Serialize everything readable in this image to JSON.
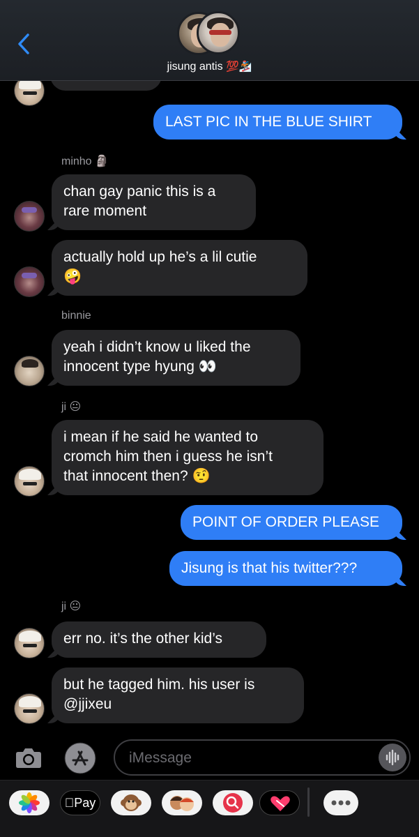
{
  "header": {
    "back_icon": "chevron-left-icon",
    "group_name": "jisung antis",
    "group_emoji": "💯🏂"
  },
  "messages": [
    {
      "side": "out",
      "text": "LAST PIC IN THE BLUE SHIRT"
    },
    {
      "side": "in",
      "sender": "minho 🗿",
      "text": "chan gay panic this is a\nrare moment"
    },
    {
      "side": "in",
      "text": "actually hold up he’s a lil cutie\n🤪"
    },
    {
      "side": "in",
      "sender": "binnie",
      "text": "yeah i didn’t know u liked the\ninnocent type hyung 👀"
    },
    {
      "side": "in",
      "sender": "ji 😐",
      "text": "i mean if he said he wanted to\ncromch him then i guess he isn’t\nthat innocent then? 🤨"
    },
    {
      "side": "out",
      "text": "POINT OF ORDER PLEASE"
    },
    {
      "side": "out",
      "text": "Jisung is that his twitter???"
    },
    {
      "side": "in",
      "sender": "ji 😐",
      "text": "err no. it’s the other kid’s"
    },
    {
      "side": "in",
      "text": "but he tagged him. his user is\n@jjixeu"
    }
  ],
  "compose": {
    "placeholder": "iMessage",
    "camera_icon": "camera-icon",
    "apps_icon": "app-store-icon",
    "audio_icon": "audio-waveform-icon"
  },
  "drawer": {
    "apps": [
      "photos-icon",
      "apple-pay-icon",
      "monkey-memoji-icon",
      "memoji-icon",
      "image-search-icon",
      "digital-touch-icon",
      "more-icon"
    ],
    "apple_pay_label": "Pay"
  },
  "colors": {
    "outgoing_bubble": "#2f7ef6",
    "incoming_bubble": "#262628",
    "accent": "#0a84ff",
    "sender_label": "#9a9a9f"
  }
}
